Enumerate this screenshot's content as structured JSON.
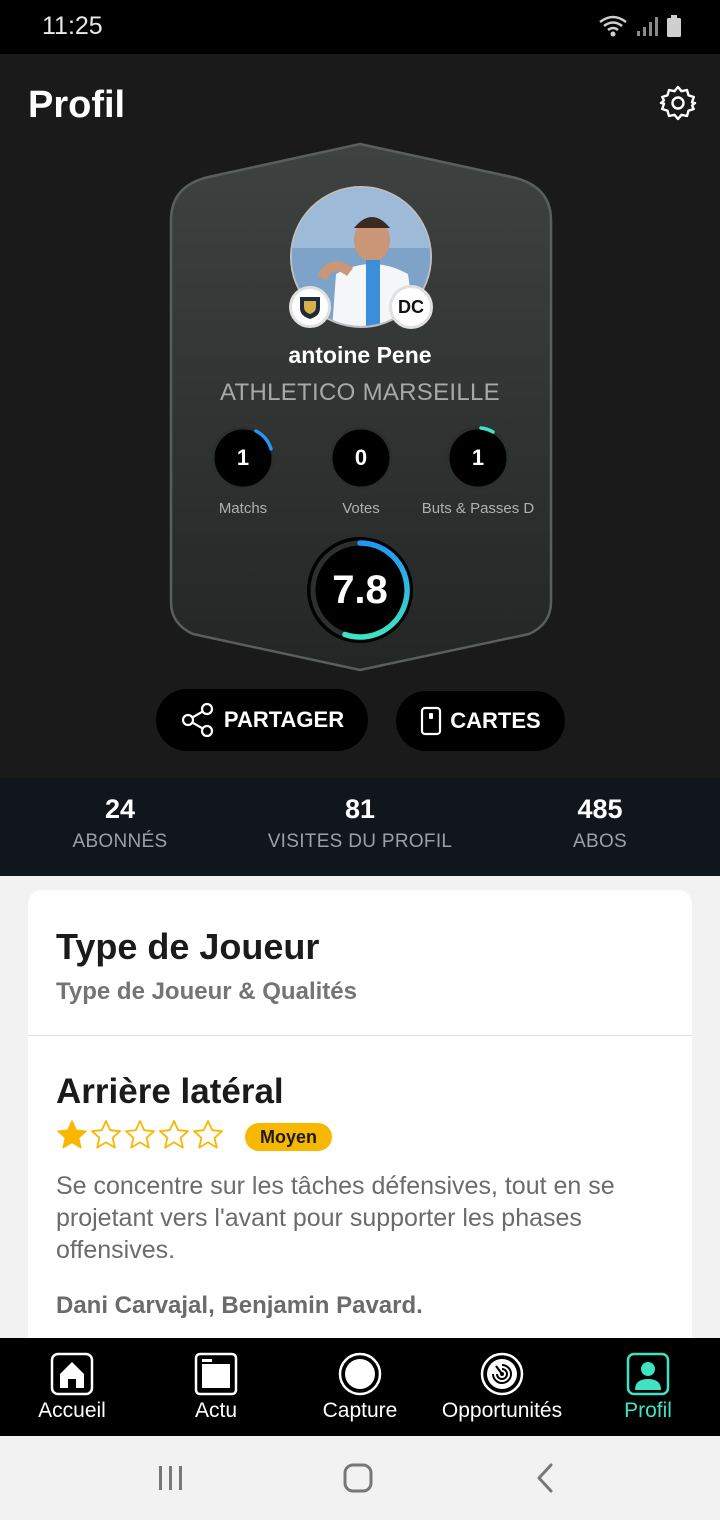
{
  "status_bar": {
    "time": "11:25"
  },
  "header": {
    "title": "Profil"
  },
  "player": {
    "name": "antoine Pene",
    "club": "ATHLETICO MARSEILLE",
    "position": "DC",
    "rating": "7.8"
  },
  "stats": [
    {
      "value": "1",
      "label": "Matchs"
    },
    {
      "value": "0",
      "label": "Votes"
    },
    {
      "value": "1",
      "label": "Buts & Passes D"
    }
  ],
  "actions": {
    "share_label": "PARTAGER",
    "cards_label": "CARTES"
  },
  "counts": [
    {
      "value": "24",
      "label": "ABONNÉS"
    },
    {
      "value": "81",
      "label": "VISITES DU PROFIL"
    },
    {
      "value": "485",
      "label": "ABOS"
    }
  ],
  "player_type": {
    "title": "Type de Joueur",
    "subtitle": "Type de Joueur & Qualités",
    "type_name": "Arrière latéral",
    "stars_filled": 1,
    "stars_total": 5,
    "level": "Moyen",
    "description": "Se concentre sur les tâches défensives, tout en se projetant vers l'avant pour supporter les phases offensives.",
    "examples": "Dani Carvajal, Benjamin Pavard."
  },
  "nav": [
    {
      "label": "Accueil",
      "icon": "home-icon"
    },
    {
      "label": "Actu",
      "icon": "news-icon"
    },
    {
      "label": "Capture",
      "icon": "capture-icon"
    },
    {
      "label": "Opportunités",
      "icon": "opportunities-icon"
    },
    {
      "label": "Profil",
      "icon": "profile-icon",
      "active": true
    }
  ],
  "colors": {
    "accent": "#3fe2c2",
    "ring_blue": "#2196f3",
    "level_badge": "#f8b700",
    "star": "#f8b700"
  }
}
